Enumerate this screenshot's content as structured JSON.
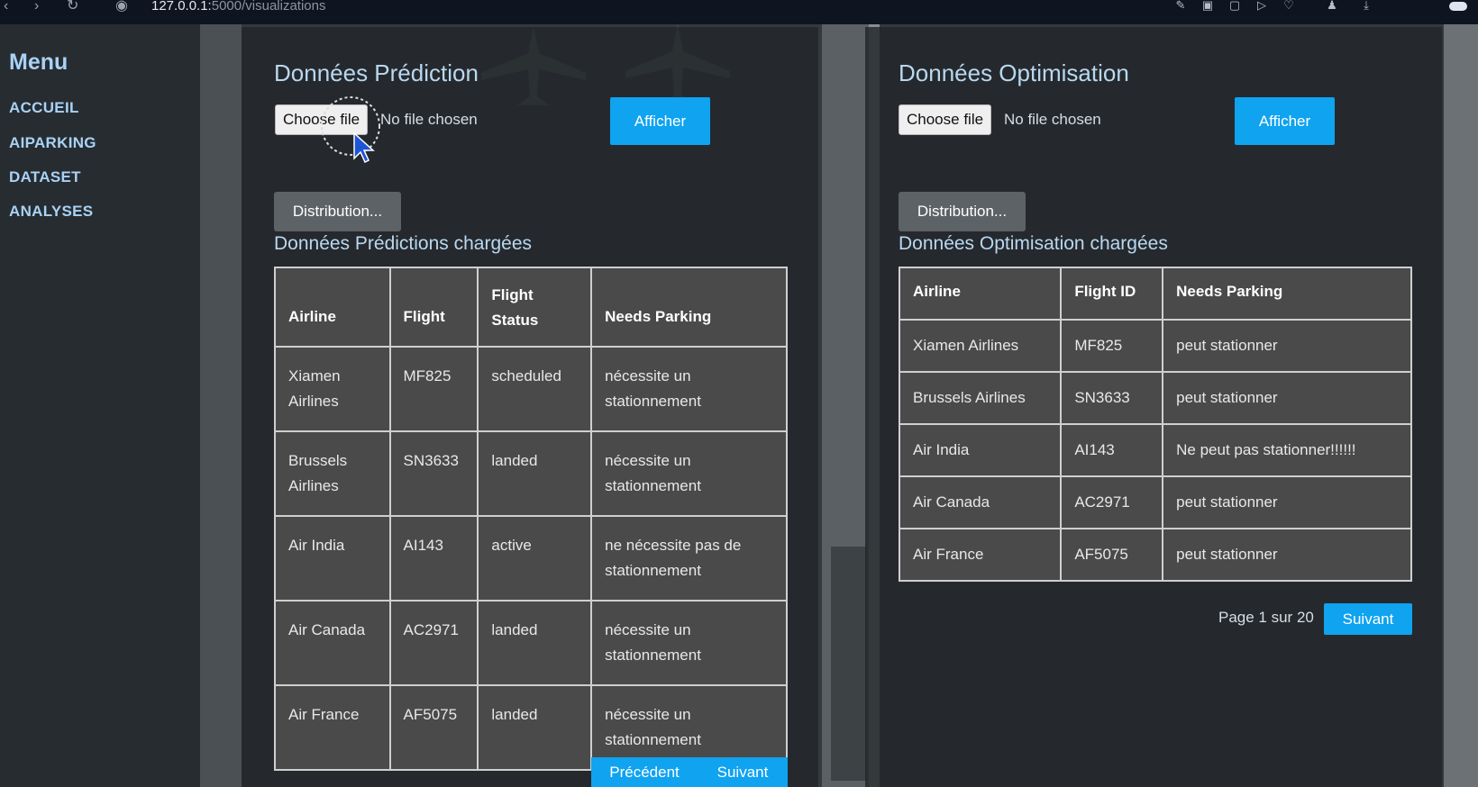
{
  "browser": {
    "url_host": "127.0.0.1:",
    "url_rest": "5000/visualizations"
  },
  "sidebar": {
    "title": "Menu",
    "items": [
      {
        "label": "ACCUEIL"
      },
      {
        "label": "AIPARKING"
      },
      {
        "label": "DATASET"
      },
      {
        "label": "ANALYSES"
      }
    ]
  },
  "prediction": {
    "title": "Données Prédiction",
    "choose_file_label": "Choose file",
    "file_status": "No file chosen",
    "afficher_label": "Afficher",
    "distribution_label": "Distribution...",
    "loaded_title": "Données Prédictions chargées",
    "columns": [
      "Airline",
      "Flight",
      "Flight Status",
      "Needs Parking"
    ],
    "rows": [
      {
        "airline": "Xiamen Airlines",
        "flight": "MF825",
        "status": "scheduled",
        "parking": "nécessite un stationnement"
      },
      {
        "airline": "Brussels Airlines",
        "flight": "SN3633",
        "status": "landed",
        "parking": "nécessite un stationnement"
      },
      {
        "airline": "Air India",
        "flight": "AI143",
        "status": "active",
        "parking": "ne nécessite pas de stationnement"
      },
      {
        "airline": "Air Canada",
        "flight": "AC2971",
        "status": "landed",
        "parking": "nécessite un stationnement"
      },
      {
        "airline": "Air France",
        "flight": "AF5075",
        "status": "landed",
        "parking": "nécessite un stationnement"
      }
    ],
    "prev_label": "Précédent",
    "next_label": "Suivant"
  },
  "optimisation": {
    "title": "Données Optimisation",
    "choose_file_label": "Choose file",
    "file_status": "No file chosen",
    "afficher_label": "Afficher",
    "distribution_label": "Distribution...",
    "loaded_title": "Données Optimisation chargées",
    "columns": [
      "Airline",
      "Flight ID",
      "Needs Parking"
    ],
    "rows": [
      {
        "airline": "Xiamen Airlines",
        "flight": "MF825",
        "parking": "peut stationner"
      },
      {
        "airline": "Brussels Airlines",
        "flight": "SN3633",
        "parking": "peut stationner"
      },
      {
        "airline": "Air India",
        "flight": "AI143",
        "parking": "Ne peut pas stationner!!!!!!"
      },
      {
        "airline": "Air Canada",
        "flight": "AC2971",
        "parking": "peut stationner"
      },
      {
        "airline": "Air France",
        "flight": "AF5075",
        "parking": "peut stationner"
      }
    ],
    "page_text": "Page 1 sur 20",
    "next_label": "Suivant"
  }
}
